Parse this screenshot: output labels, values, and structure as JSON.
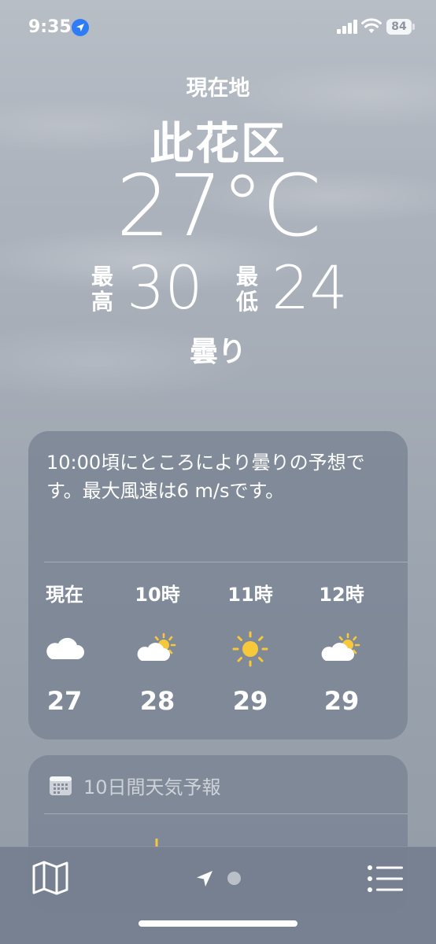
{
  "status_bar": {
    "time": "9:35",
    "battery": "84",
    "location_arrow_color": "#2f7df6"
  },
  "header": {
    "location_label": "現在地",
    "city": "此花区",
    "temperature": "27°C",
    "high_label": "最高",
    "high": "30",
    "low_label": "最低",
    "low": "24",
    "condition": "曇り"
  },
  "hourly": {
    "summary": "10:00頃にところにより曇りの予想です。最大風速は6 m/sです。",
    "items": [
      {
        "label": "現在",
        "icon": "cloud-icon",
        "temp": "27"
      },
      {
        "label": "10時",
        "icon": "partly-sunny-icon",
        "temp": "28"
      },
      {
        "label": "11時",
        "icon": "sun-icon",
        "temp": "29"
      },
      {
        "label": "12時",
        "icon": "partly-sunny-icon",
        "temp": "29"
      }
    ]
  },
  "forecast_10day": {
    "title": "10日間天気予報",
    "icon": "calendar-icon"
  },
  "toolbar": {
    "map_icon": "map-icon",
    "location_icon": "location-arrow-icon",
    "list_icon": "list-icon"
  },
  "colors": {
    "sun": "#f6c83a",
    "card": "#7a8494"
  }
}
